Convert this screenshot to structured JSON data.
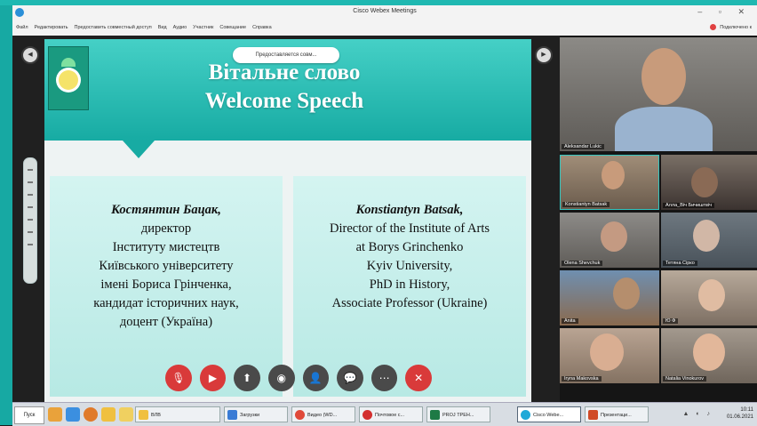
{
  "window": {
    "title": "Cisco Webex Meetings",
    "controls": "– ▫ ✕"
  },
  "menubar": {
    "items": [
      "Файл",
      "Редактировать",
      "Предоставить совместный доступ",
      "Вид",
      "Аудио",
      "Участник",
      "Совещание",
      "Справка"
    ],
    "connection": "Подключено к"
  },
  "share": {
    "banner": "Предоставляется совм..."
  },
  "slide": {
    "title_ua": "Вітальне слово",
    "title_en": "Welcome Speech",
    "left_panel": {
      "name": "Костянтин Бацак,",
      "lines": [
        "директор",
        "Інституту мистецтв",
        "Київського університету",
        "імені Бориса Грінченка,",
        "кандидат історичних наук,",
        "доцент (Україна)"
      ]
    },
    "right_panel": {
      "name": "Konstiantyn Batsak,",
      "lines": [
        "Director of the Institute of Arts",
        "at Borys Grinchenko",
        "Kyiv University,",
        "PhD in History,",
        "Associate Professor (Ukraine)"
      ]
    }
  },
  "participants": {
    "active": "Aleksandar Lukic",
    "tiles": [
      "Konstiantyn Batsak",
      "Алла_Віч Бичиштвіч",
      "Olena Shevchuk",
      "Тетяна Сірко",
      "Anita",
      "Ю Ф",
      "Iryna Makovska",
      "Natalia Vinokurov"
    ]
  },
  "controls": {
    "mute": "mic-icon",
    "video": "video-icon",
    "share": "share-icon",
    "record": "record-icon",
    "participants": "participants-icon",
    "chat": "chat-icon",
    "more": "more-icon",
    "end": "end-call-icon"
  },
  "taskbar": {
    "start": "Пуск",
    "tasks": [
      "ВЛВ",
      "Загрузки",
      "Видео (WD...",
      "Почтовое с...",
      "PROJ ТРЕН...",
      "Cisco Webe...",
      "Презентаци..."
    ],
    "time": "10:11",
    "date": "01.06.2021"
  },
  "colors": {
    "teal": "#17aba3",
    "end_call": "#d93a3a"
  }
}
